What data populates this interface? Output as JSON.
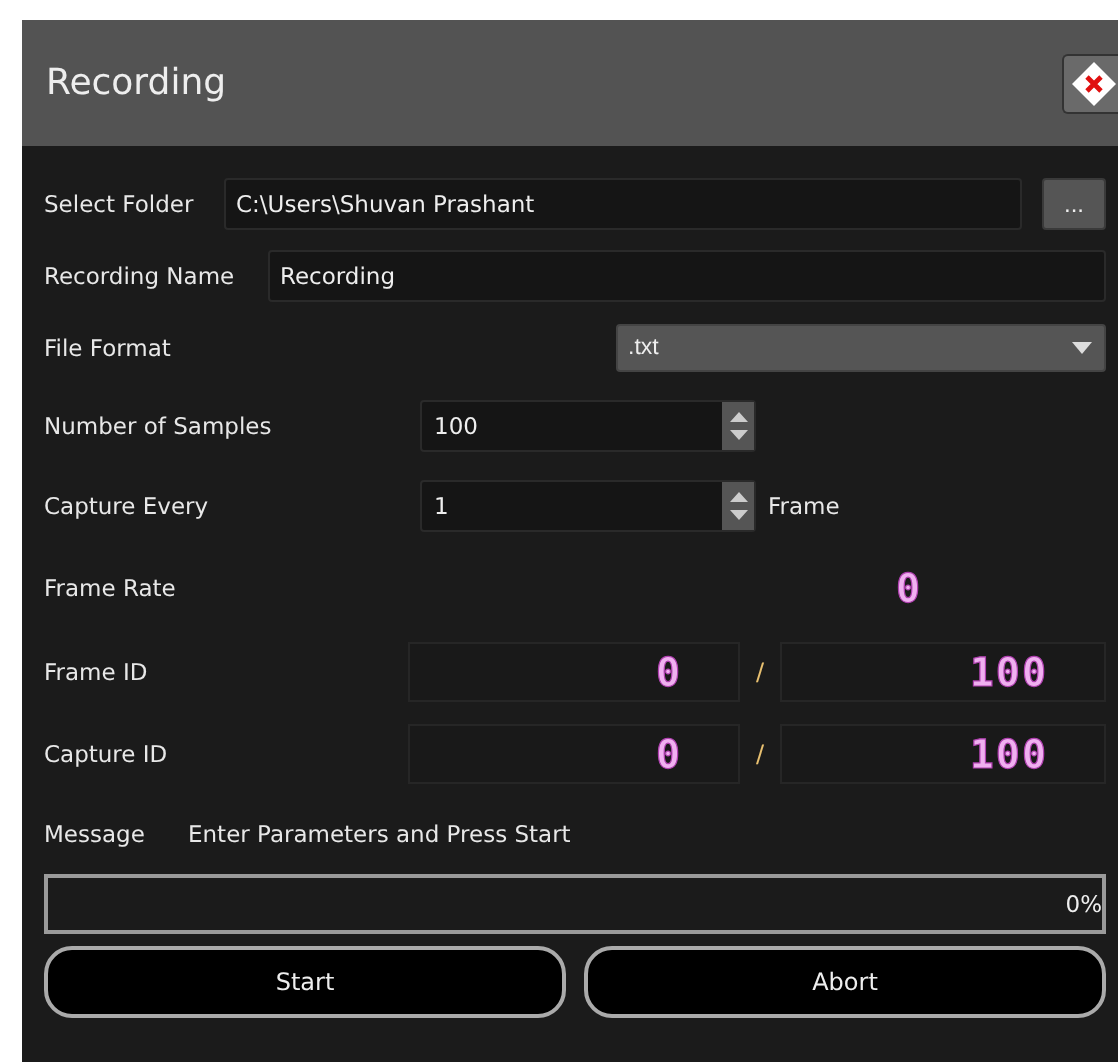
{
  "window": {
    "title": "Recording"
  },
  "folder": {
    "label": "Select Folder",
    "value": "C:\\Users\\Shuvan Prashant",
    "browse": "..."
  },
  "name": {
    "label": "Recording Name",
    "value": "Recording"
  },
  "format": {
    "label": "File Format",
    "value": ".txt"
  },
  "samples": {
    "label": "Number of Samples",
    "value": "100"
  },
  "capture_every": {
    "label": "Capture Every",
    "value": "1",
    "unit": "Frame"
  },
  "frame_rate": {
    "label": "Frame Rate",
    "value": "0"
  },
  "counters": [
    {
      "label": "Frame ID",
      "current": "0",
      "separator": "/",
      "total": "100"
    },
    {
      "label": "Capture ID",
      "current": "0",
      "separator": "/",
      "total": "100"
    }
  ],
  "message": {
    "label": "Message",
    "text": "Enter Parameters and Press Start"
  },
  "progress": {
    "level": 0,
    "reading": "0%"
  },
  "buttons": [
    "Start",
    "Abort"
  ]
}
